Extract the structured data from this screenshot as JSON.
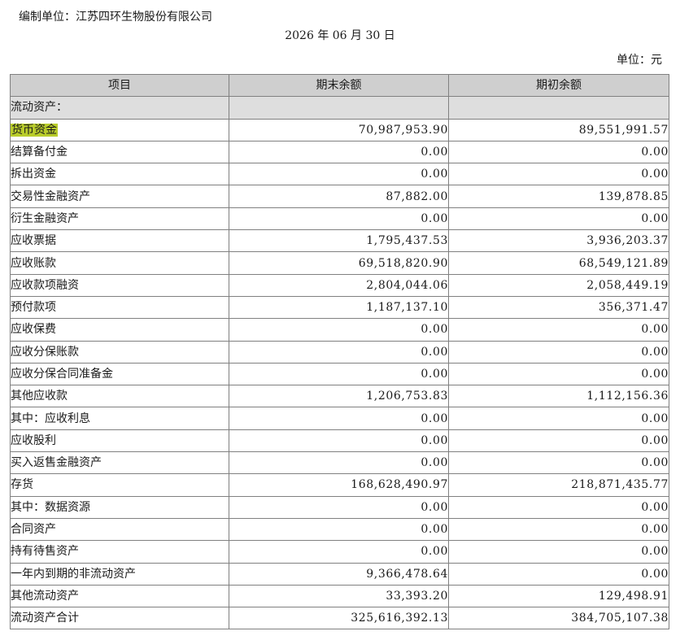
{
  "header": {
    "compiler": "编制单位：江苏四环生物股份有限公司",
    "date": "2026 年 06 月 30 日",
    "unit": "单位：元"
  },
  "columns": [
    "项目",
    "期末余额",
    "期初余额"
  ],
  "section_label": "流动资产：",
  "rows": [
    {
      "label": "货币资金",
      "end": "70,987,953.90",
      "begin": "89,551,991.57"
    },
    {
      "label": "结算备付金",
      "end": "0.00",
      "begin": "0.00"
    },
    {
      "label": "拆出资金",
      "end": "0.00",
      "begin": "0.00"
    },
    {
      "label": "交易性金融资产",
      "end": "87,882.00",
      "begin": "139,878.85"
    },
    {
      "label": "衍生金融资产",
      "end": "0.00",
      "begin": "0.00"
    },
    {
      "label": "应收票据",
      "end": "1,795,437.53",
      "begin": "3,936,203.37"
    },
    {
      "label": "应收账款",
      "end": "69,518,820.90",
      "begin": "68,549,121.89"
    },
    {
      "label": "应收款项融资",
      "end": "2,804,044.06",
      "begin": "2,058,449.19"
    },
    {
      "label": "预付款项",
      "end": "1,187,137.10",
      "begin": "356,371.47"
    },
    {
      "label": "应收保费",
      "end": "0.00",
      "begin": "0.00"
    },
    {
      "label": "应收分保账款",
      "end": "0.00",
      "begin": "0.00"
    },
    {
      "label": "应收分保合同准备金",
      "end": "0.00",
      "begin": "0.00"
    },
    {
      "label": "其他应收款",
      "end": "1,206,753.83",
      "begin": "1,112,156.36"
    },
    {
      "label": "其中：应收利息",
      "end": "0.00",
      "begin": "0.00"
    },
    {
      "label": "应收股利",
      "end": "0.00",
      "begin": "0.00"
    },
    {
      "label": "买入返售金融资产",
      "end": "0.00",
      "begin": "0.00"
    },
    {
      "label": "存货",
      "end": "168,628,490.97",
      "begin": "218,871,435.77"
    },
    {
      "label": "其中：数据资源",
      "end": "0.00",
      "begin": "0.00"
    },
    {
      "label": "合同资产",
      "end": "0.00",
      "begin": "0.00"
    },
    {
      "label": "持有待售资产",
      "end": "0.00",
      "begin": "0.00"
    },
    {
      "label": "一年内到期的非流动资产",
      "end": "9,366,478.64",
      "begin": "0.00"
    },
    {
      "label": "其他流动资产",
      "end": "33,393.20",
      "begin": "129,498.91"
    }
  ],
  "total": {
    "label": "流动资产合计",
    "end": "325,616,392.13",
    "begin": "384,705,107.38"
  },
  "colors": {
    "header_bg": "#cfcfcf",
    "section_bg": "#dedede",
    "highlight": "#b8cc2a",
    "border": "#808080"
  }
}
